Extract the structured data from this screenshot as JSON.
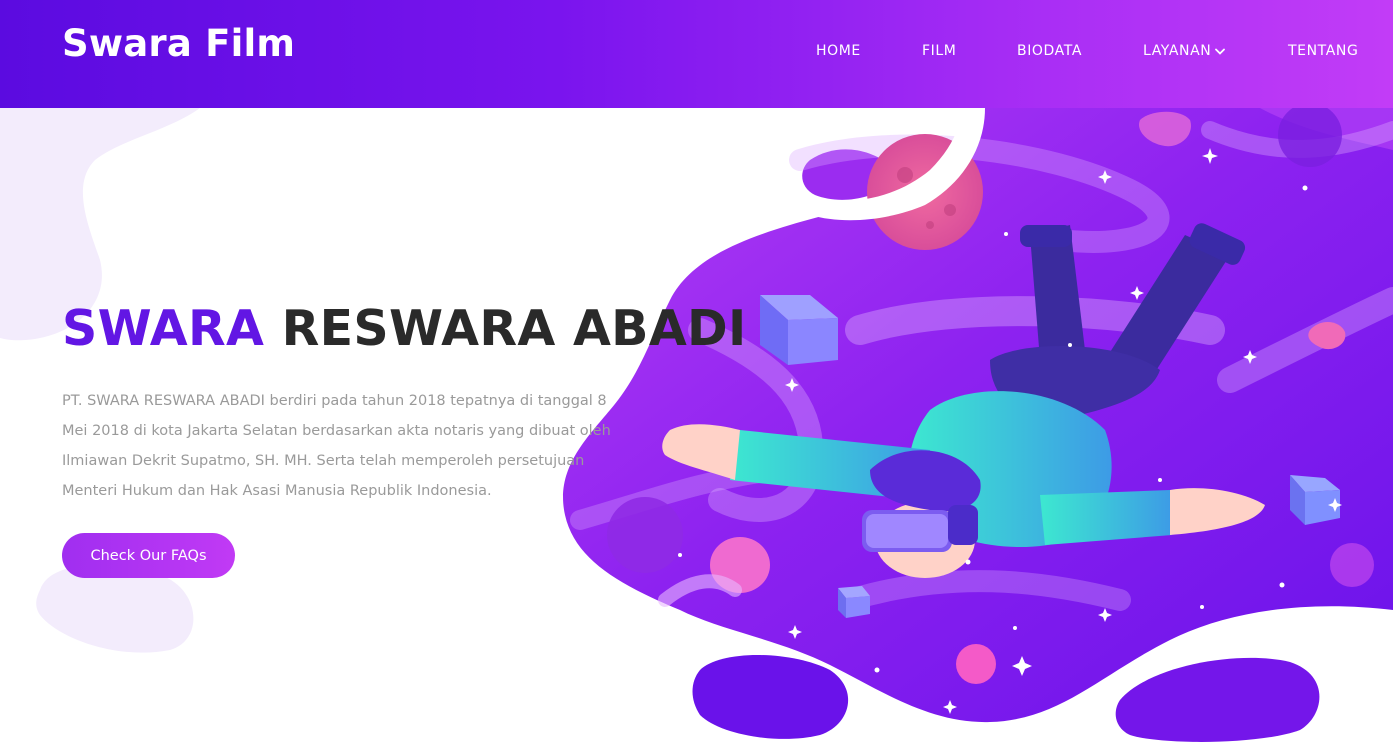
{
  "header": {
    "brand": "Swara Film",
    "nav": [
      {
        "label": "HOME"
      },
      {
        "label": "FILM"
      },
      {
        "label": "BIODATA"
      },
      {
        "label": "LAYANAN"
      },
      {
        "label": "TENTANG"
      }
    ]
  },
  "hero": {
    "title_accent": "SWARA",
    "title_rest": "RESWARA ABADI",
    "description": "PT. SWARA RESWARA ABADI berdiri pada tahun 2018 tepatnya di tanggal 8 Mei 2018 di kota Jakarta Selatan berdasarkan akta notaris yang dibuat oleh Ilmiawan Dekrit Supatmo, SH. MH. Serta telah memperoleh persetujuan Menteri Hukum dan Hak Asasi Manusia Republik Indonesia.",
    "cta_label": "Check Our FAQs"
  },
  "colors": {
    "header_start": "#5b0be0",
    "header_end": "#c23cf7",
    "accent": "#6216e4",
    "button": "#b035f2"
  },
  "icons": {
    "nav_dropdown": "chevron-down-icon"
  }
}
